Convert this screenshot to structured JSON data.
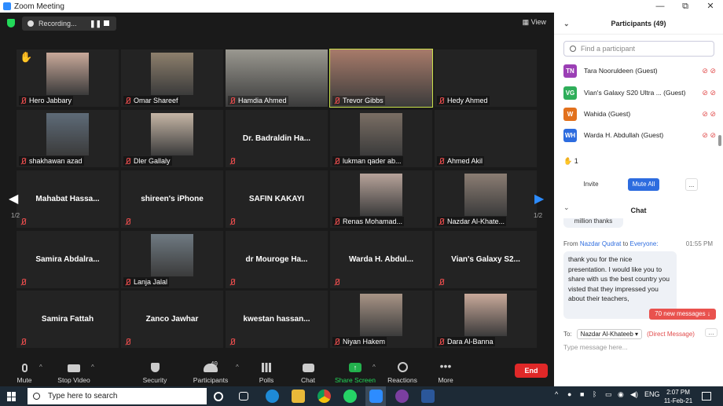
{
  "window": {
    "title": "Zoom Meeting",
    "restore": "⧉",
    "minimize": "—",
    "close": "✕"
  },
  "topbar": {
    "recording_label": "Recording...",
    "view_label": "View"
  },
  "grid": {
    "page_indicator": "1/2",
    "tiles": [
      {
        "label": "Hero Jabbary",
        "big": "",
        "video": true,
        "hand": true
      },
      {
        "label": "Omar Shareef",
        "big": "",
        "video": true
      },
      {
        "label": "Hamdia Ahmed",
        "big": "",
        "video": true
      },
      {
        "label": "Trevor Gibbs",
        "big": "",
        "video": true,
        "active": true
      },
      {
        "label": "Hedy Ahmed",
        "big": "",
        "video": false
      },
      {
        "label": "shakhawan azad",
        "big": "",
        "video": true
      },
      {
        "label": "Dler Gallaly",
        "big": "",
        "video": true
      },
      {
        "label": "",
        "big": "Dr. Badraldin Ha...",
        "video": false
      },
      {
        "label": "lukman qader ab...",
        "big": "",
        "video": true
      },
      {
        "label": "Ahmed Akil",
        "big": "",
        "video": false
      },
      {
        "label": "",
        "big": "Mahabat Hassa...",
        "video": false
      },
      {
        "label": "",
        "big": "shireen's iPhone",
        "video": false
      },
      {
        "label": "",
        "big": "SAFIN KAKAYI",
        "video": false
      },
      {
        "label": "Renas Mohamad...",
        "big": "",
        "video": true
      },
      {
        "label": "Nazdar Al-Khate...",
        "big": "",
        "video": true
      },
      {
        "label": "",
        "big": "Samira Abdalra...",
        "video": false
      },
      {
        "label": "Lanja Jalal",
        "big": "",
        "video": true
      },
      {
        "label": "",
        "big": "dr Mourоge Ha...",
        "video": false
      },
      {
        "label": "",
        "big": "Warda H. Abdul...",
        "video": false
      },
      {
        "label": "",
        "big": "Vian's Galaxy S2...",
        "video": false
      },
      {
        "label": "",
        "big": "Samira Fattah",
        "video": false
      },
      {
        "label": "",
        "big": "Zanco Jawhar",
        "video": false
      },
      {
        "label": "",
        "big": "kwestan hassan...",
        "video": false
      },
      {
        "label": "Niyan Hakem",
        "big": "",
        "video": true
      },
      {
        "label": "Dara Al-Banna",
        "big": "",
        "video": true
      }
    ]
  },
  "toolbar": {
    "mute": "Mute",
    "stop_video": "Stop Video",
    "security": "Security",
    "participants": "Participants",
    "participants_count": "49",
    "polls": "Polls",
    "chat": "Chat",
    "share_screen": "Share Screen",
    "reactions": "Reactions",
    "more": "More",
    "end": "End"
  },
  "participants_panel": {
    "title": "Participants (49)",
    "search_placeholder": "Find a participant",
    "rows": [
      {
        "initials": "TN",
        "name": "Tara Nooruldeen (Guest)",
        "color": "#9b3fb5"
      },
      {
        "initials": "VG",
        "name": "Vian's Galaxy S20 Ultra ...  (Guest)",
        "color": "#2fae5a"
      },
      {
        "initials": "W",
        "name": "Wahida (Guest)",
        "color": "#e2711d"
      },
      {
        "initials": "WH",
        "name": "Warda H. Abdullah (Guest)",
        "color": "#2d6cdf"
      }
    ],
    "raised_hands": "1",
    "invite": "Invite",
    "mute_all": "Mute All",
    "more": "..."
  },
  "chat_panel": {
    "title": "Chat",
    "prev_message": "million thanks",
    "from_prefix": "From",
    "from_name": "Nazdar Qudrat",
    "to_word": "to",
    "to_name": "Everyone:",
    "time": "01:55 PM",
    "message": "thank you for the nice presentation. I would like you to share with us the best country you visted that they impressed you about their teachers,",
    "new_messages": "70 new messages ↓",
    "to_label": "To:",
    "to_select": "Nazdar Al-Khateeb ▾",
    "direct": "(Direct Message)",
    "placeholder": "Type message here..."
  },
  "taskbar": {
    "search_placeholder": "Type here to search",
    "time": "2:07 PM",
    "date": "11-Feb-21",
    "lang": "ENG"
  },
  "colors": {
    "active_speaker": "#c9e24a",
    "end": "#e02828",
    "accent": "#2d8cff"
  }
}
